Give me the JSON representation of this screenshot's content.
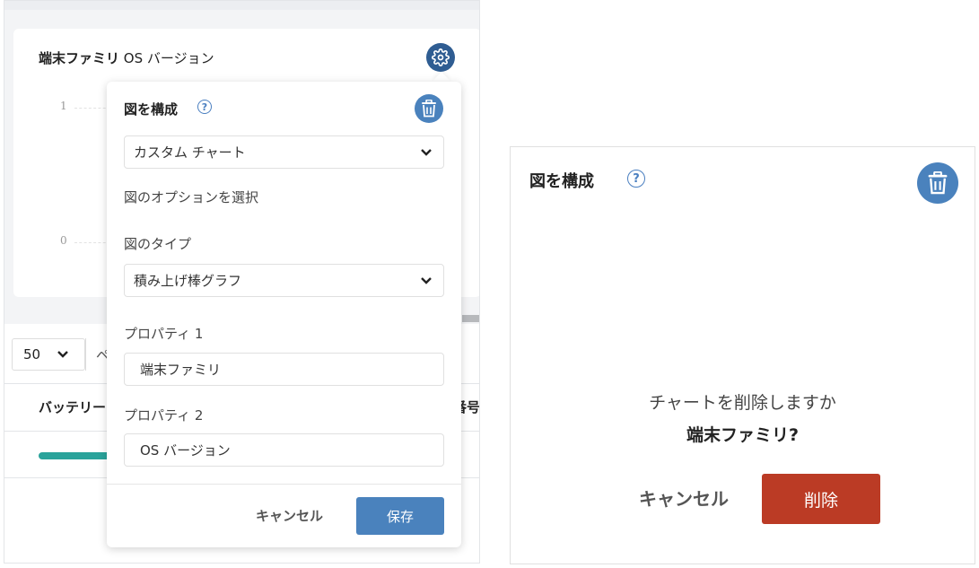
{
  "left_panel": {
    "chart_card": {
      "title_bold": "端末ファミリ",
      "title_rest": "OS バージョン",
      "y_ticks": [
        "1",
        "0"
      ]
    },
    "table": {
      "page_size": "50",
      "page_size_suffix": "ペ",
      "col_headers": [
        "バッテリー",
        "番号"
      ]
    },
    "popover": {
      "title": "図を構成",
      "chart_select": "カスタム チャート",
      "options_heading": "図のオプションを選択",
      "chart_type_label": "図のタイプ",
      "chart_type_select": "積み上げ棒グラフ",
      "property1_label": "プロパティ 1",
      "property1_value": "端末ファミリ",
      "property2_label": "プロパティ 2",
      "property2_value": "OS バージョン",
      "cancel_label": "キャンセル",
      "save_label": "保存"
    }
  },
  "right_panel": {
    "title": "図を構成",
    "confirm_question": "チャートを削除しますか",
    "confirm_chart_name": "端末ファミリ?",
    "cancel_label": "キャンセル",
    "delete_label": "削除"
  },
  "colors": {
    "accent_blue": "#4a82bd",
    "dark_blue": "#2f5d92",
    "delete_red": "#bb3b25",
    "battery_teal": "#2aa39b"
  },
  "icons": [
    "gear-icon",
    "help-icon",
    "trash-icon",
    "chevron-down-icon"
  ]
}
